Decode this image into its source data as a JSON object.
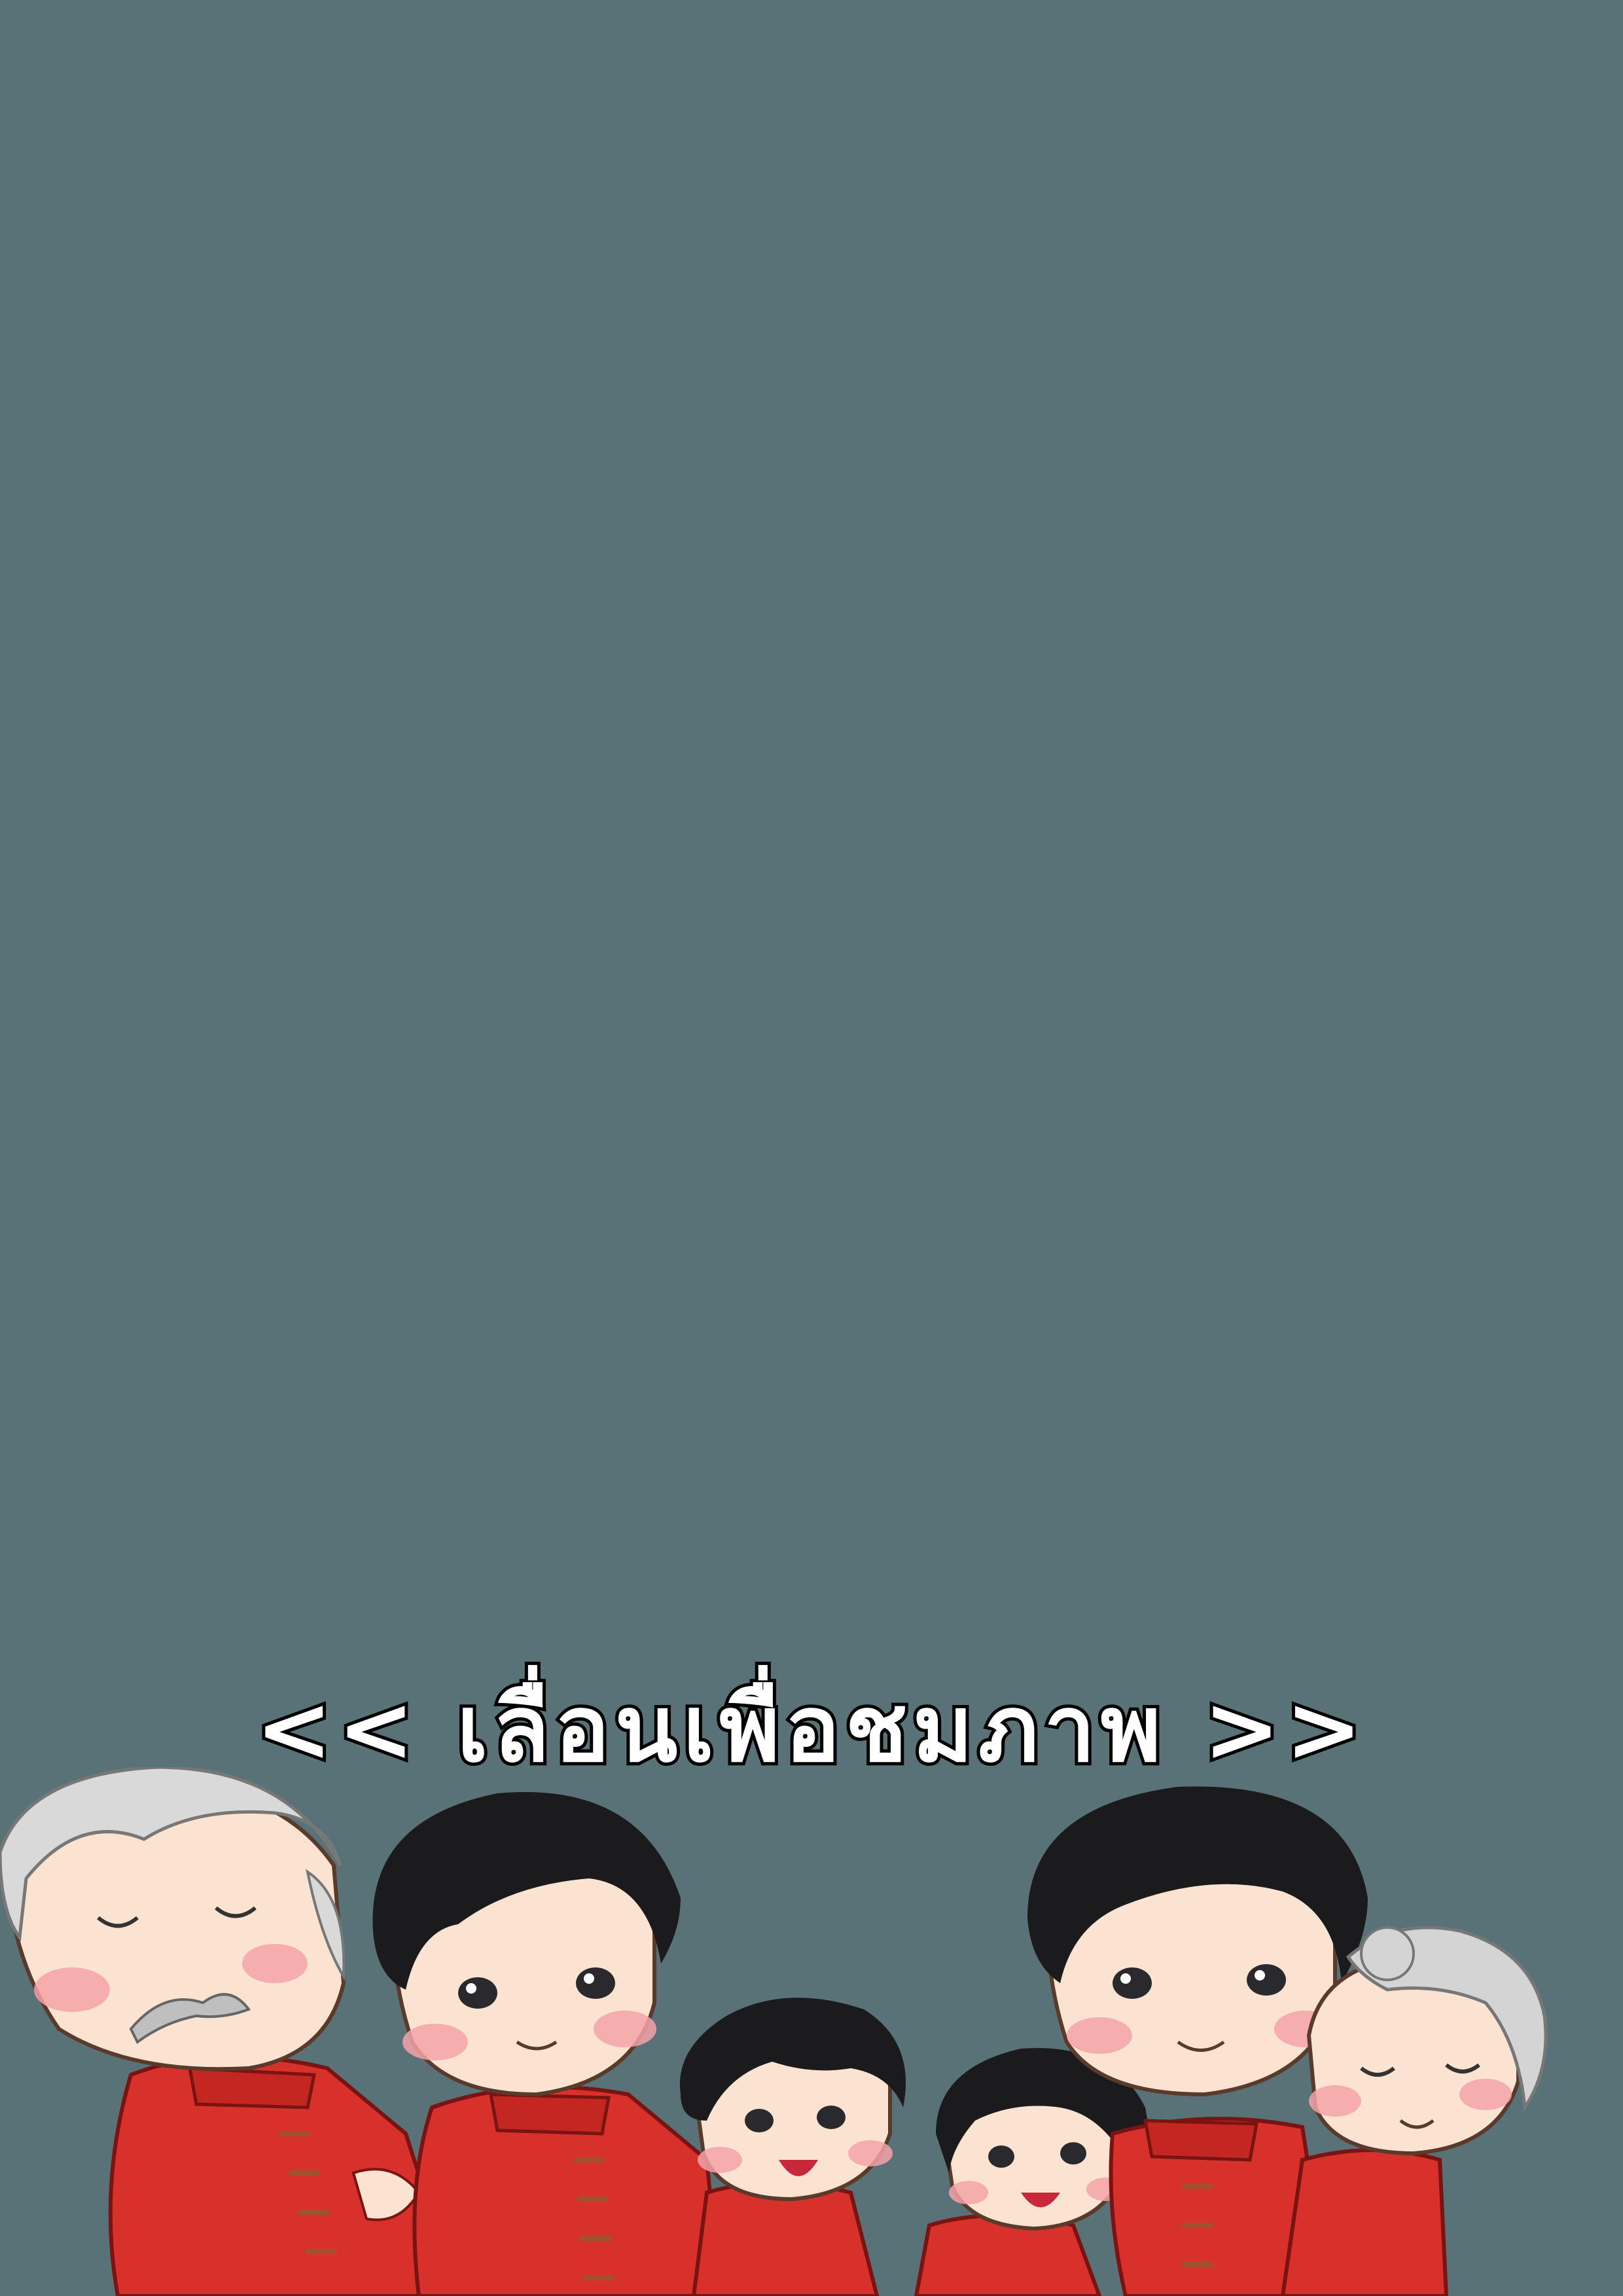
{
  "background_color": "#597278",
  "scroll_hint": {
    "text": "<< เลื่อนเพื่อชมภาพ >>",
    "fill_color": "#ffffff",
    "outline_color": "#000000"
  },
  "illustration": {
    "figures": [
      {
        "name": "grandfather",
        "hair": "#d9d9d9",
        "outfit": "#d8312c"
      },
      {
        "name": "father",
        "hair": "#1b1b1d",
        "outfit": "#d8312c"
      },
      {
        "name": "son",
        "hair": "#1b1b1d",
        "outfit": "#d8312c"
      },
      {
        "name": "daughter",
        "hair": "#1b1b1d",
        "outfit": "#d8312c"
      },
      {
        "name": "mother",
        "hair": "#1b1b1d",
        "outfit": "#d8312c"
      },
      {
        "name": "grandmother",
        "hair": "#d4d4d4",
        "outfit": "#d8312c"
      }
    ],
    "skin_color": "#fbe3d2",
    "blush_color": "#f5a3a8"
  }
}
